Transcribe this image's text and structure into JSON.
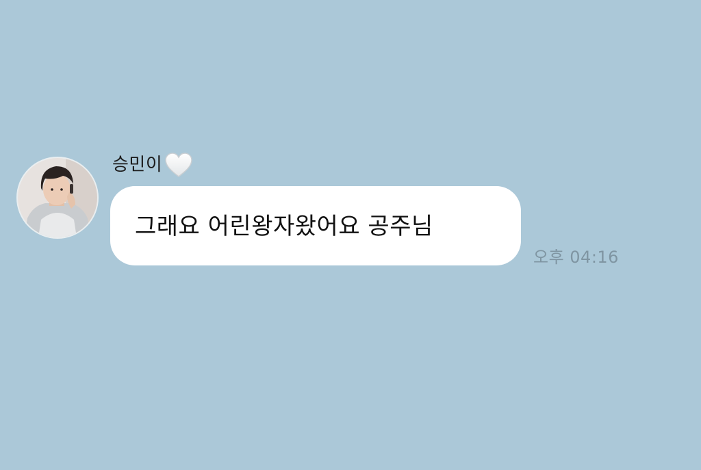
{
  "chat": {
    "background_color": "#abc8d8",
    "message": {
      "sender": {
        "name": "승민이",
        "name_emoji_icon": "white-heart-icon",
        "avatar_icon": "profile-photo-avatar"
      },
      "text": "그래요 어린왕자왔어요 공주님",
      "time": "오후 04:16",
      "bubble_color": "#ffffff"
    }
  }
}
